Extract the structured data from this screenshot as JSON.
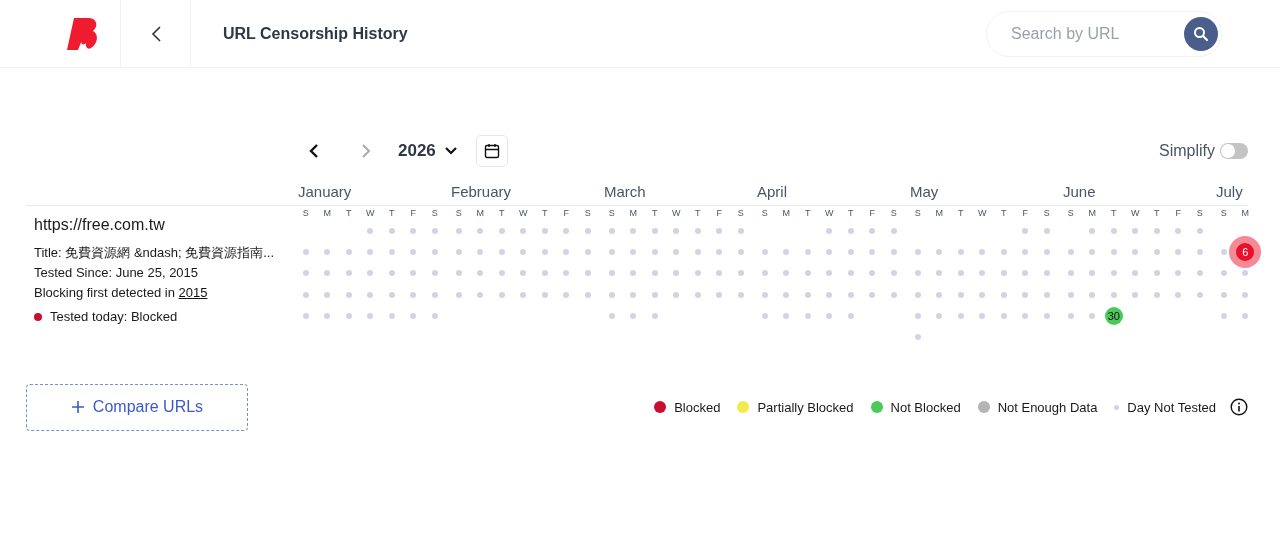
{
  "header": {
    "title": "URL Censorship History",
    "search": {
      "placeholder": "Search by URL"
    }
  },
  "year_nav": {
    "year": "2026",
    "prev": {
      "disabled": false
    },
    "next": {
      "disabled": true
    }
  },
  "simplify": {
    "label": "Simplify",
    "on": false
  },
  "url_info": {
    "url": "https://free.com.tw",
    "lines": [
      {
        "text": "Title: 免費資源網 &ndash; 免費資源指南..."
      },
      {
        "text": "Tested Since: June 25, 2015"
      },
      {
        "text": "Blocking first detected in",
        "link": "2015"
      }
    ],
    "status": {
      "text": "Tested today: Blocked",
      "color": "#c8102e"
    }
  },
  "calendar": {
    "months": [
      {
        "name": "January",
        "weekdays": [
          "S",
          "M",
          "T",
          "W",
          "T",
          "F",
          "S"
        ],
        "weeks": [
          [
            {
              "kind": "empty"
            },
            {
              "kind": "empty"
            },
            {
              "kind": "empty"
            },
            {
              "kind": "dot"
            },
            {
              "kind": "dot"
            },
            {
              "kind": "dot"
            },
            {
              "kind": "dot"
            }
          ],
          [
            {
              "kind": "dot"
            },
            {
              "kind": "dot"
            },
            {
              "kind": "dot"
            },
            {
              "kind": "dot"
            },
            {
              "kind": "dot"
            },
            {
              "kind": "dot"
            },
            {
              "kind": "dot"
            }
          ],
          [
            {
              "kind": "dot"
            },
            {
              "kind": "dot"
            },
            {
              "kind": "dot"
            },
            {
              "kind": "dot"
            },
            {
              "kind": "dot"
            },
            {
              "kind": "dot"
            },
            {
              "kind": "dot"
            }
          ],
          [
            {
              "kind": "dot"
            },
            {
              "kind": "dot"
            },
            {
              "kind": "dot"
            },
            {
              "kind": "dot"
            },
            {
              "kind": "dot"
            },
            {
              "kind": "dot"
            },
            {
              "kind": "dot"
            }
          ],
          [
            {
              "kind": "dot"
            },
            {
              "kind": "dot"
            },
            {
              "kind": "dot"
            },
            {
              "kind": "dot"
            },
            {
              "kind": "dot"
            },
            {
              "kind": "dot"
            },
            {
              "kind": "dot"
            }
          ]
        ]
      },
      {
        "name": "February",
        "weekdays": [
          "S",
          "M",
          "T",
          "W",
          "T",
          "F",
          "S"
        ],
        "weeks": [
          [
            {
              "kind": "dot"
            },
            {
              "kind": "dot"
            },
            {
              "kind": "dot"
            },
            {
              "kind": "dot"
            },
            {
              "kind": "dot"
            },
            {
              "kind": "dot"
            },
            {
              "kind": "dot"
            }
          ],
          [
            {
              "kind": "dot"
            },
            {
              "kind": "dot"
            },
            {
              "kind": "dot"
            },
            {
              "kind": "dot"
            },
            {
              "kind": "dot"
            },
            {
              "kind": "dot"
            },
            {
              "kind": "dot"
            }
          ],
          [
            {
              "kind": "dot"
            },
            {
              "kind": "dot"
            },
            {
              "kind": "dot"
            },
            {
              "kind": "dot"
            },
            {
              "kind": "dot"
            },
            {
              "kind": "dot"
            },
            {
              "kind": "dot"
            }
          ],
          [
            {
              "kind": "dot"
            },
            {
              "kind": "dot"
            },
            {
              "kind": "dot"
            },
            {
              "kind": "dot"
            },
            {
              "kind": "dot"
            },
            {
              "kind": "dot"
            },
            {
              "kind": "dot"
            }
          ]
        ]
      },
      {
        "name": "March",
        "weekdays": [
          "S",
          "M",
          "T",
          "W",
          "T",
          "F",
          "S"
        ],
        "weeks": [
          [
            {
              "kind": "dot"
            },
            {
              "kind": "dot"
            },
            {
              "kind": "dot"
            },
            {
              "kind": "dot"
            },
            {
              "kind": "dot"
            },
            {
              "kind": "dot"
            },
            {
              "kind": "dot"
            }
          ],
          [
            {
              "kind": "dot"
            },
            {
              "kind": "dot"
            },
            {
              "kind": "dot"
            },
            {
              "kind": "dot"
            },
            {
              "kind": "dot"
            },
            {
              "kind": "dot"
            },
            {
              "kind": "dot"
            }
          ],
          [
            {
              "kind": "dot"
            },
            {
              "kind": "dot"
            },
            {
              "kind": "dot"
            },
            {
              "kind": "dot"
            },
            {
              "kind": "dot"
            },
            {
              "kind": "dot"
            },
            {
              "kind": "dot"
            }
          ],
          [
            {
              "kind": "dot"
            },
            {
              "kind": "dot"
            },
            {
              "kind": "dot"
            },
            {
              "kind": "dot"
            },
            {
              "kind": "dot"
            },
            {
              "kind": "dot"
            },
            {
              "kind": "dot"
            }
          ],
          [
            {
              "kind": "dot"
            },
            {
              "kind": "dot"
            },
            {
              "kind": "dot"
            },
            {
              "kind": "empty"
            },
            {
              "kind": "empty"
            },
            {
              "kind": "empty"
            },
            {
              "kind": "empty"
            }
          ]
        ]
      },
      {
        "name": "April",
        "weekdays": [
          "S",
          "M",
          "T",
          "W",
          "T",
          "F",
          "S"
        ],
        "weeks": [
          [
            {
              "kind": "empty"
            },
            {
              "kind": "empty"
            },
            {
              "kind": "empty"
            },
            {
              "kind": "dot"
            },
            {
              "kind": "dot"
            },
            {
              "kind": "dot"
            },
            {
              "kind": "dot"
            }
          ],
          [
            {
              "kind": "dot"
            },
            {
              "kind": "dot"
            },
            {
              "kind": "dot"
            },
            {
              "kind": "dot"
            },
            {
              "kind": "dot"
            },
            {
              "kind": "dot"
            },
            {
              "kind": "dot"
            }
          ],
          [
            {
              "kind": "dot"
            },
            {
              "kind": "dot"
            },
            {
              "kind": "dot"
            },
            {
              "kind": "dot"
            },
            {
              "kind": "dot"
            },
            {
              "kind": "dot"
            },
            {
              "kind": "dot"
            }
          ],
          [
            {
              "kind": "dot"
            },
            {
              "kind": "dot"
            },
            {
              "kind": "dot"
            },
            {
              "kind": "dot"
            },
            {
              "kind": "dot"
            },
            {
              "kind": "dot"
            },
            {
              "kind": "dot"
            }
          ],
          [
            {
              "kind": "dot"
            },
            {
              "kind": "dot"
            },
            {
              "kind": "dot"
            },
            {
              "kind": "dot"
            },
            {
              "kind": "dot"
            },
            {
              "kind": "empty"
            },
            {
              "kind": "empty"
            }
          ]
        ]
      },
      {
        "name": "May",
        "weekdays": [
          "S",
          "M",
          "T",
          "W",
          "T",
          "F",
          "S"
        ],
        "weeks": [
          [
            {
              "kind": "empty"
            },
            {
              "kind": "empty"
            },
            {
              "kind": "empty"
            },
            {
              "kind": "empty"
            },
            {
              "kind": "empty"
            },
            {
              "kind": "dot"
            },
            {
              "kind": "dot"
            }
          ],
          [
            {
              "kind": "dot"
            },
            {
              "kind": "dot"
            },
            {
              "kind": "dot"
            },
            {
              "kind": "dot"
            },
            {
              "kind": "dot"
            },
            {
              "kind": "dot"
            },
            {
              "kind": "dot"
            }
          ],
          [
            {
              "kind": "dot"
            },
            {
              "kind": "dot"
            },
            {
              "kind": "dot"
            },
            {
              "kind": "dot"
            },
            {
              "kind": "dot"
            },
            {
              "kind": "dot"
            },
            {
              "kind": "dot"
            }
          ],
          [
            {
              "kind": "dot"
            },
            {
              "kind": "dot"
            },
            {
              "kind": "dot"
            },
            {
              "kind": "dot"
            },
            {
              "kind": "dot"
            },
            {
              "kind": "dot"
            },
            {
              "kind": "dot"
            }
          ],
          [
            {
              "kind": "dot"
            },
            {
              "kind": "dot"
            },
            {
              "kind": "dot"
            },
            {
              "kind": "dot"
            },
            {
              "kind": "dot"
            },
            {
              "kind": "dot"
            },
            {
              "kind": "dot"
            }
          ],
          [
            {
              "kind": "dot"
            },
            {
              "kind": "empty"
            },
            {
              "kind": "empty"
            },
            {
              "kind": "empty"
            },
            {
              "kind": "empty"
            },
            {
              "kind": "empty"
            },
            {
              "kind": "empty"
            }
          ]
        ]
      },
      {
        "name": "June",
        "weekdays": [
          "S",
          "M",
          "T",
          "W",
          "T",
          "F",
          "S"
        ],
        "weeks": [
          [
            {
              "kind": "empty"
            },
            {
              "kind": "dot"
            },
            {
              "kind": "dot"
            },
            {
              "kind": "dot"
            },
            {
              "kind": "dot"
            },
            {
              "kind": "dot"
            },
            {
              "kind": "dot"
            }
          ],
          [
            {
              "kind": "dot"
            },
            {
              "kind": "dot"
            },
            {
              "kind": "dot"
            },
            {
              "kind": "dot"
            },
            {
              "kind": "dot"
            },
            {
              "kind": "dot"
            },
            {
              "kind": "dot"
            }
          ],
          [
            {
              "kind": "dot"
            },
            {
              "kind": "dot"
            },
            {
              "kind": "dot"
            },
            {
              "kind": "dot"
            },
            {
              "kind": "dot"
            },
            {
              "kind": "dot"
            },
            {
              "kind": "dot"
            }
          ],
          [
            {
              "kind": "dot"
            },
            {
              "kind": "dot"
            },
            {
              "kind": "dot"
            },
            {
              "kind": "dot"
            },
            {
              "kind": "dot"
            },
            {
              "kind": "dot"
            },
            {
              "kind": "dot"
            }
          ],
          [
            {
              "kind": "dot"
            },
            {
              "kind": "dot"
            },
            {
              "kind": "badge",
              "color": "#4cc95a",
              "label": "30"
            },
            {
              "kind": "empty"
            },
            {
              "kind": "empty"
            },
            {
              "kind": "empty"
            },
            {
              "kind": "empty"
            }
          ]
        ]
      },
      {
        "name": "July",
        "weekdays": [
          "S",
          "M"
        ],
        "weeks": [
          [
            {
              "kind": "empty"
            },
            {
              "kind": "empty"
            }
          ],
          [
            {
              "kind": "dot"
            },
            {
              "kind": "halo-badge",
              "color": "#e8102a",
              "label": "6"
            }
          ],
          [
            {
              "kind": "dot"
            },
            {
              "kind": "dot"
            }
          ],
          [
            {
              "kind": "dot"
            },
            {
              "kind": "dot"
            }
          ],
          [
            {
              "kind": "dot"
            },
            {
              "kind": "dot"
            }
          ]
        ]
      }
    ]
  },
  "compare_button": {
    "label": "Compare URLs"
  },
  "legend": [
    {
      "label": "Blocked",
      "color": "#c8102e"
    },
    {
      "label": "Partially Blocked",
      "color": "#f2ea4b"
    },
    {
      "label": "Not Blocked",
      "color": "#4cc95a"
    },
    {
      "label": "Not Enough Data",
      "color": "#b4b4b4"
    },
    {
      "label": "Day Not Tested",
      "color": "#d3d3e6",
      "kind": "small"
    }
  ]
}
